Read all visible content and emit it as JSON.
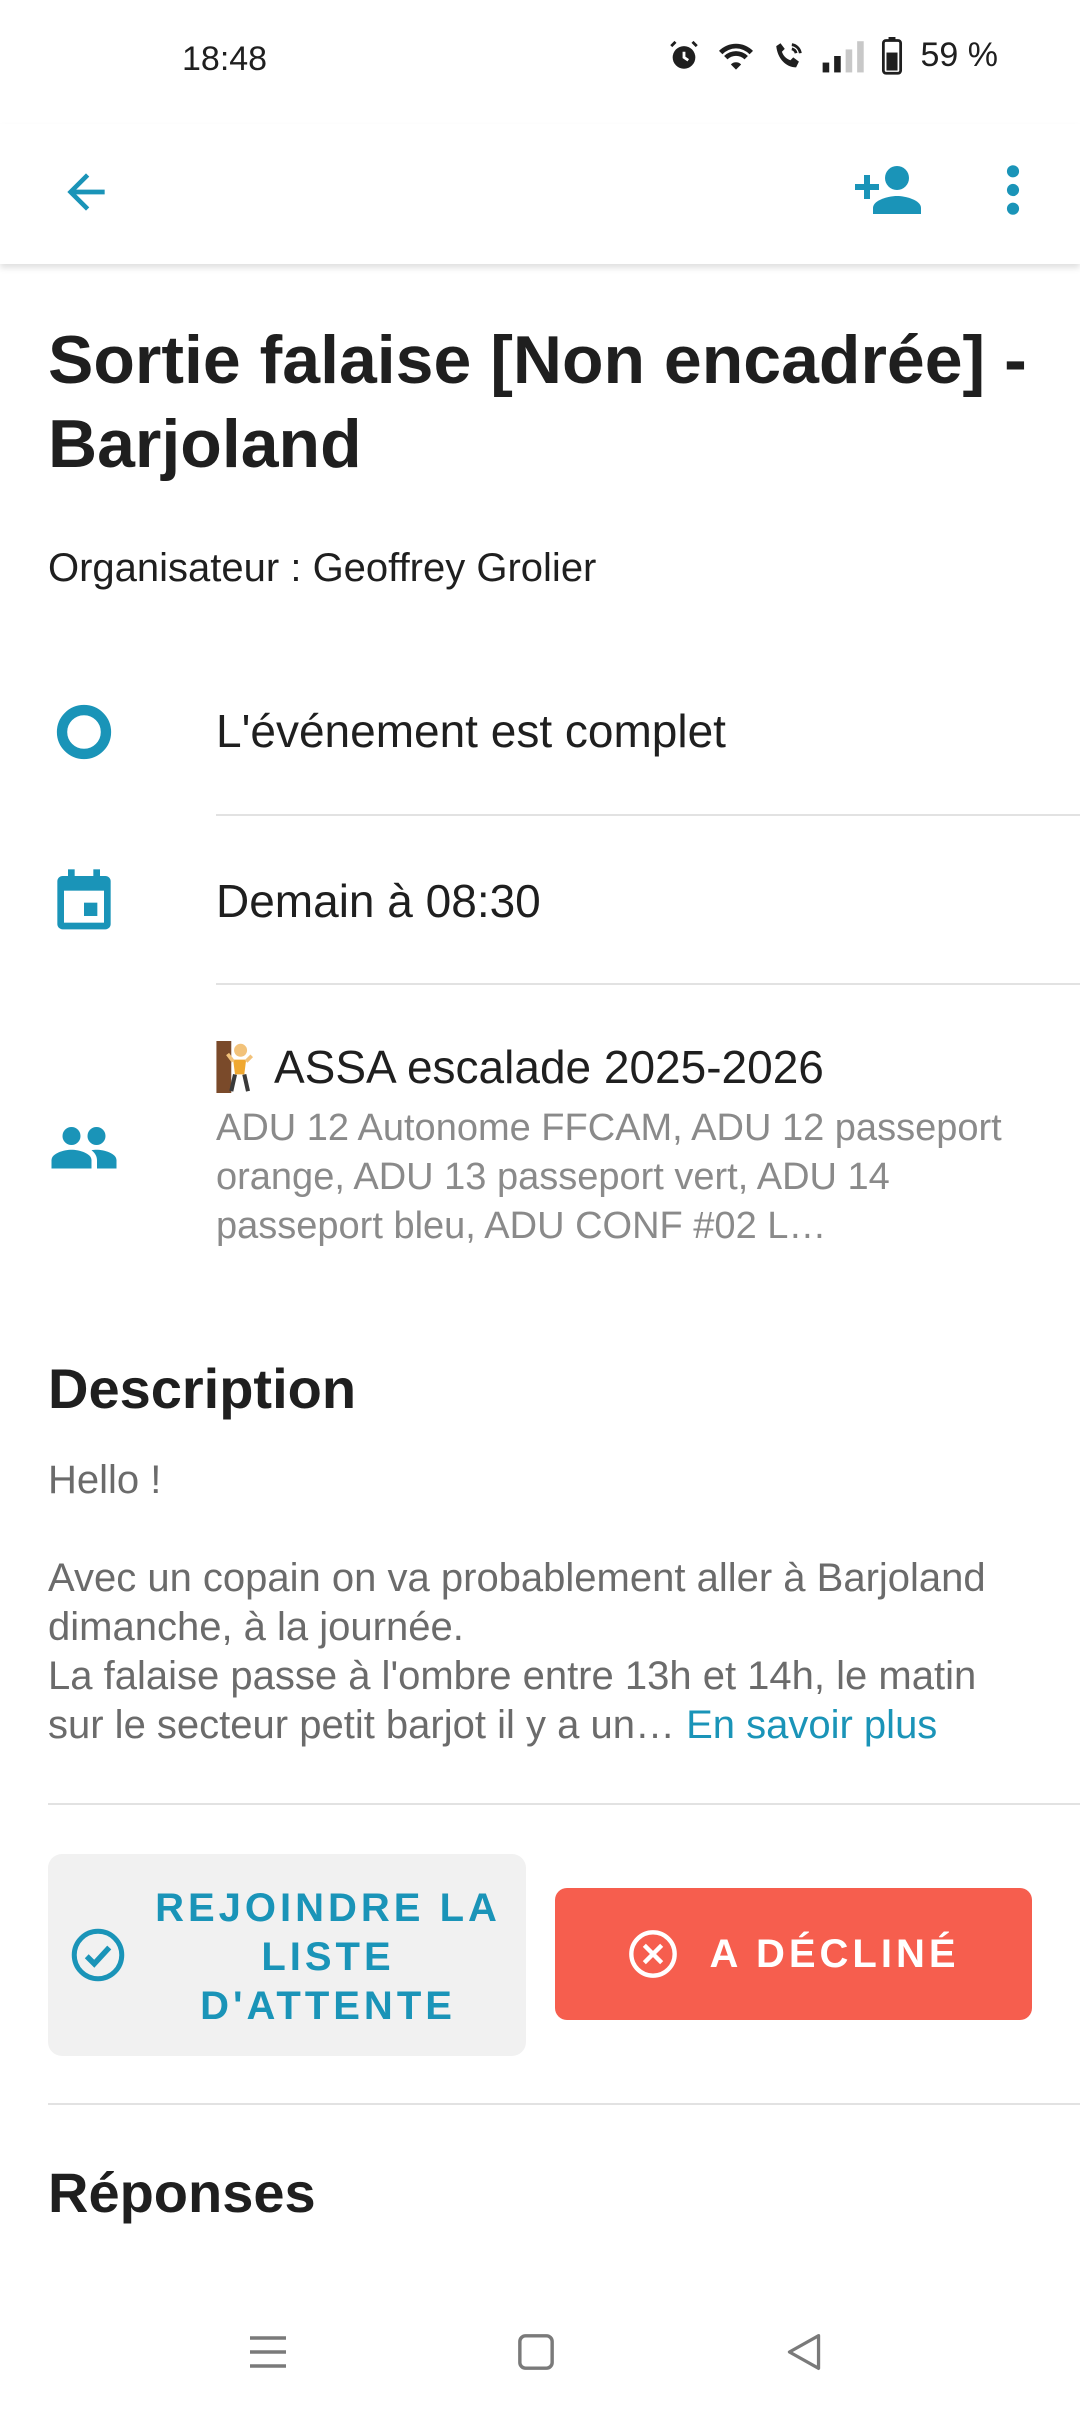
{
  "status_bar": {
    "time": "18:48",
    "battery": "59 %",
    "icons": [
      "alarm-icon",
      "wifi-icon",
      "wifi-call-icon",
      "signal-icon",
      "battery-icon"
    ]
  },
  "app_bar": {
    "icons": [
      "arrow-back-icon",
      "person-add-icon",
      "more-vert-icon"
    ],
    "accent_color": "#1a94b8"
  },
  "event": {
    "title": "Sortie falaise [Non encadrée] - Barjoland",
    "organizer": "Organisateur : Geoffrey Grolier",
    "status": "L'événement est complet",
    "date": "Demain à 08:30",
    "group_name": "ASSA escalade 2025-2026",
    "group_members": "ADU 12 Autonome FFCAM, ADU 12 passeport orange, ADU 13 passeport vert, ADU 14 passeport bleu, ADU CONF #02 L…"
  },
  "description": {
    "heading": "Description",
    "para1": "Hello !",
    "para2_line1": "Avec un copain on va probablement aller à Barjoland dimanche, à la journée.",
    "para2_line2": "La falaise passe à l'ombre entre 13h et 14h, le matin sur le secteur petit barjot il y a un…",
    "read_more": "En savoir plus"
  },
  "actions": {
    "waitlist_label": "REJOINDRE LA LISTE D'ATTENTE",
    "declined_label": "A DÉCLINÉ",
    "declined_color": "#f65e4e"
  },
  "responses": {
    "heading": "Réponses"
  }
}
